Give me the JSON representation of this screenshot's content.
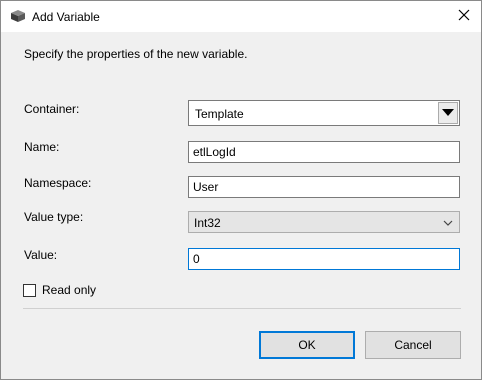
{
  "window": {
    "title": "Add Variable",
    "close_icon": "close-icon",
    "app_icon": "package-icon"
  },
  "description": "Specify the properties of the new variable.",
  "form": {
    "container": {
      "label": "Container:",
      "value": "Template"
    },
    "name": {
      "label": "Name:",
      "value": "etlLogId"
    },
    "namespace": {
      "label": "Namespace:",
      "value": "User"
    },
    "value_type": {
      "label": "Value type:",
      "value": "Int32"
    },
    "value": {
      "label": "Value:",
      "value": "0"
    },
    "read_only": {
      "label": "Read only",
      "checked": false
    }
  },
  "buttons": {
    "ok": "OK",
    "cancel": "Cancel"
  },
  "colors": {
    "accent": "#0078d7",
    "content_bg": "#f0f0f0"
  }
}
